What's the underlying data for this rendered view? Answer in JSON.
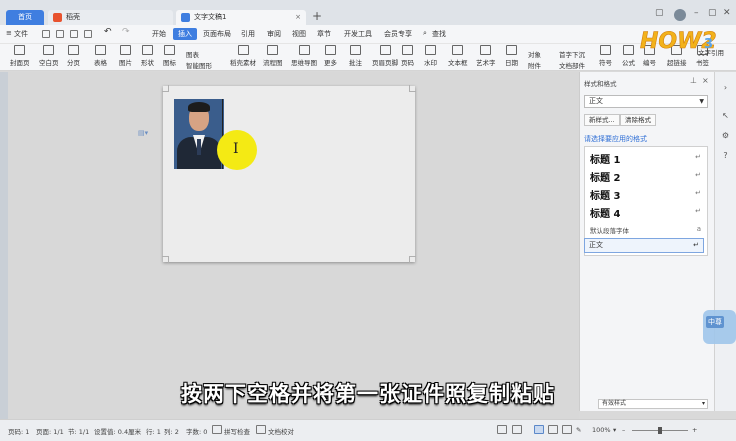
{
  "tabs": {
    "home": "首页",
    "shell": "稻壳",
    "doc": "文字文稿1"
  },
  "menu": {
    "file": "文件",
    "items": [
      "开始",
      "插入",
      "页面布局",
      "引用",
      "审阅",
      "视图",
      "章节",
      "开发工具",
      "会员专享"
    ],
    "active_index": 1,
    "search": "查找"
  },
  "ribbon": {
    "items": [
      "封面页",
      "空白页",
      "分页",
      "表格",
      "图片",
      "形状",
      "图标",
      "图表",
      "智能图形",
      "稻壳素材",
      "流程图",
      "思维导图",
      "更多",
      "批注",
      "页眉页脚",
      "页码",
      "水印",
      "文本框",
      "艺术字",
      "日期",
      "附件",
      "对象",
      "首字下沉",
      "文档部件",
      "符号",
      "公式",
      "编号",
      "超链接",
      "书签"
    ]
  },
  "logo_text": "文字引用",
  "style_pane": {
    "title": "样式和格式",
    "current_style": "正文",
    "new_style": "新样式...",
    "clear_format": "清除格式",
    "hint": "请选择要应用的格式",
    "styles": [
      "标题 1",
      "标题 2",
      "标题 3",
      "标题 4"
    ],
    "default_font": "默认段落字体",
    "selected": "正文",
    "bottom_option": "有效样式",
    "badge": "中尊"
  },
  "subtitle": "按两下空格并将第一张证件照复制粘贴",
  "status": {
    "page": "页码: 1",
    "pages": "页面: 1/1",
    "section": "节: 1/1",
    "setting": "设置值: 0.4厘米",
    "row": "行: 1",
    "col": "列: 2",
    "words": "字数: 0",
    "spell": "拼写检查",
    "proof": "文档校对",
    "zoom": "100%"
  },
  "zoom_fraction": 0.5,
  "colors": {
    "accent": "#3f7ee0",
    "highlight": "#f4ea14",
    "link": "#2f6fd6"
  },
  "icons": [
    "save-icon",
    "print-icon",
    "undo-icon",
    "redo-icon",
    "search-icon",
    "pin-icon",
    "close-icon",
    "cursor-icon",
    "settings-icon",
    "help-icon",
    "paragraph-icon"
  ]
}
